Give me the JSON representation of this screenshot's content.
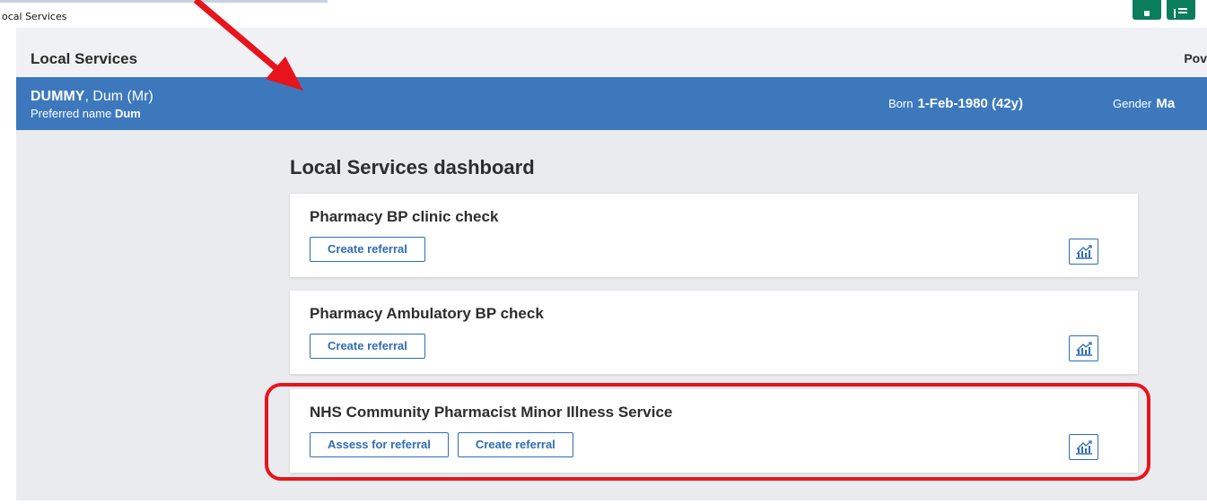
{
  "window": {
    "tab_title": "ocal Services"
  },
  "app": {
    "title": "Local Services",
    "right_text": "Pov"
  },
  "patient": {
    "surname": "DUMMY",
    "name_rest": ", Dum (Mr)",
    "preferred_label": "Preferred name",
    "preferred_name": "Dum",
    "born_label": "Born",
    "born_value": "1-Feb-1980 (42y)",
    "gender_label": "Gender",
    "gender_value": "Ma"
  },
  "dashboard": {
    "title": "Local Services dashboard",
    "cards": [
      {
        "title": "Pharmacy BP clinic check",
        "buttons": [
          "Create referral"
        ]
      },
      {
        "title": "Pharmacy Ambulatory BP check",
        "buttons": [
          "Create referral"
        ]
      },
      {
        "title": "NHS Community Pharmacist Minor Illness Service",
        "buttons": [
          "Assess for referral",
          "Create referral"
        ]
      }
    ]
  },
  "annotations": {
    "arrow_color": "#e8141c",
    "highlight_color": "#e8141c"
  },
  "colors": {
    "banner": "#3d78bd",
    "accent": "#2f6db5",
    "background": "#e9ebef",
    "brand": "#0a7d5c"
  },
  "icons": {
    "stats": "chart-growth-icon",
    "brand": "nhs-logo-icon"
  }
}
